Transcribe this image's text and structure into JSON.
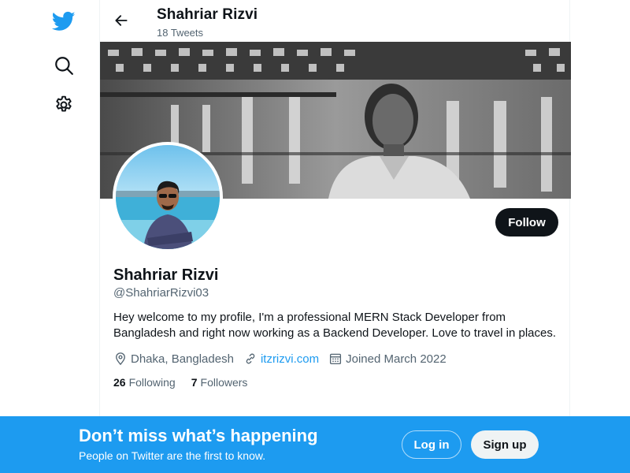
{
  "nav": {
    "items": [
      {
        "icon": "twitter-logo-icon"
      },
      {
        "icon": "search-icon"
      },
      {
        "icon": "gear-icon"
      }
    ]
  },
  "header": {
    "title": "Shahriar Rizvi",
    "subtitle": "18 Tweets"
  },
  "profile": {
    "name": "Shahriar Rizvi",
    "handle": "@ShahriarRizvi03",
    "bio": "Hey welcome to my profile, I'm a professional MERN Stack Developer from Bangladesh and right now working as a Backend Developer. Love to travel in places.",
    "location": "Dhaka, Bangladesh",
    "website": "itzrizvi.com",
    "joined": "Joined March 2022",
    "following_count": "26",
    "following_label": "Following",
    "followers_count": "7",
    "followers_label": "Followers",
    "follow_label": "Follow"
  },
  "bottom_bar": {
    "title": "Don’t miss what’s happening",
    "subtitle": "People on Twitter are the first to know.",
    "login_label": "Log in",
    "signup_label": "Sign up"
  },
  "colors": {
    "brand": "#1d9bf0",
    "text": "#0f1419",
    "muted": "#536471"
  }
}
